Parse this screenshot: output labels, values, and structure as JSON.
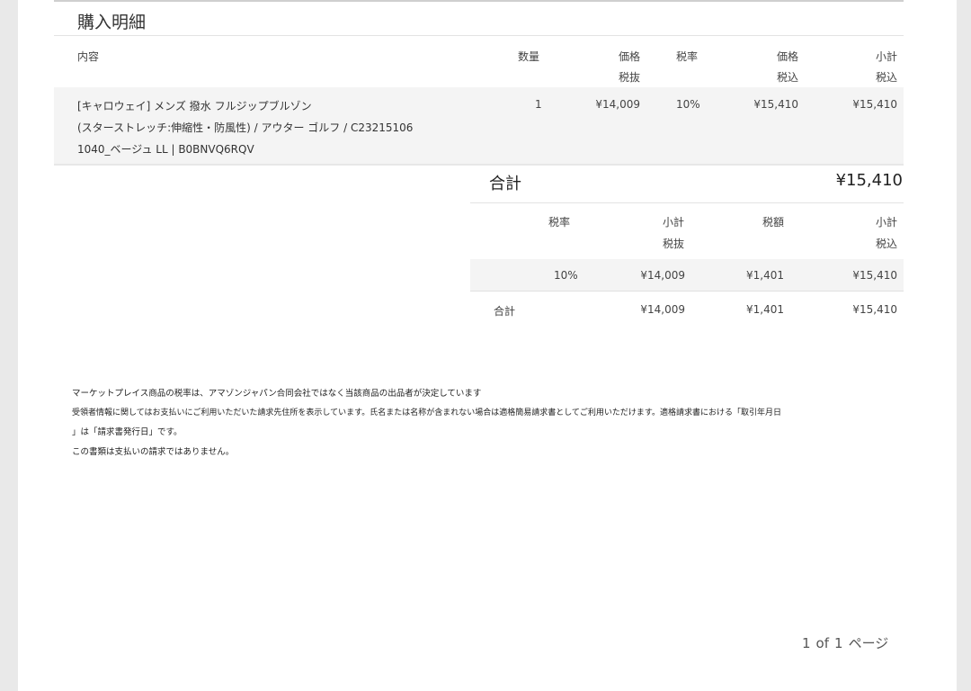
{
  "section_title": "購入明細",
  "columns": {
    "content": "内容",
    "qty": "数量",
    "price_ex_1": "価格",
    "price_ex_2": "税抜",
    "tax_rate": "税率",
    "price_in_1": "価格",
    "price_in_2": "税込",
    "subtotal_in_1": "小計",
    "subtotal_in_2": "税込"
  },
  "item": {
    "desc_line1": "[キャロウェイ] メンズ 撥水 フルジップブルゾン",
    "desc_line2": "(スターストレッチ:伸縮性・防風性) / アウター ゴルフ / C23215106",
    "desc_line3": "1040_ベージュ LL | B0BNVQ6RQV",
    "qty": "1",
    "price_ex": "¥14,009",
    "tax_rate": "10%",
    "price_in": "¥15,410",
    "subtotal_in": "¥15,410"
  },
  "total": {
    "label": "合計",
    "value": "¥15,410"
  },
  "tax_table": {
    "headers": {
      "rate": "税率",
      "subtotal_ex_1": "小計",
      "subtotal_ex_2": "税抜",
      "tax_amount": "税額",
      "subtotal_in_1": "小計",
      "subtotal_in_2": "税込"
    },
    "row": {
      "rate": "10%",
      "subtotal_ex": "¥14,009",
      "tax_amount": "¥1,401",
      "subtotal_in": "¥15,410"
    },
    "sum": {
      "label": "合計",
      "subtotal_ex": "¥14,009",
      "tax_amount": "¥1,401",
      "subtotal_in": "¥15,410"
    }
  },
  "notes": [
    "マーケットプレイス商品の税率は、アマゾンジャパン合同会社ではなく当該商品の出品者が決定しています",
    "受領者情報に関してはお支払いにご利用いただいた請求先住所を表示しています。氏名または名称が含まれない場合は適格簡易請求書としてご利用いただけます。適格請求書における「取引年月日",
    "」は「請求書発行日」です。",
    "この書類は支払いの請求ではありません。"
  ],
  "pager": {
    "current": "1",
    "of": "of",
    "total": "1",
    "unit": "ページ"
  }
}
